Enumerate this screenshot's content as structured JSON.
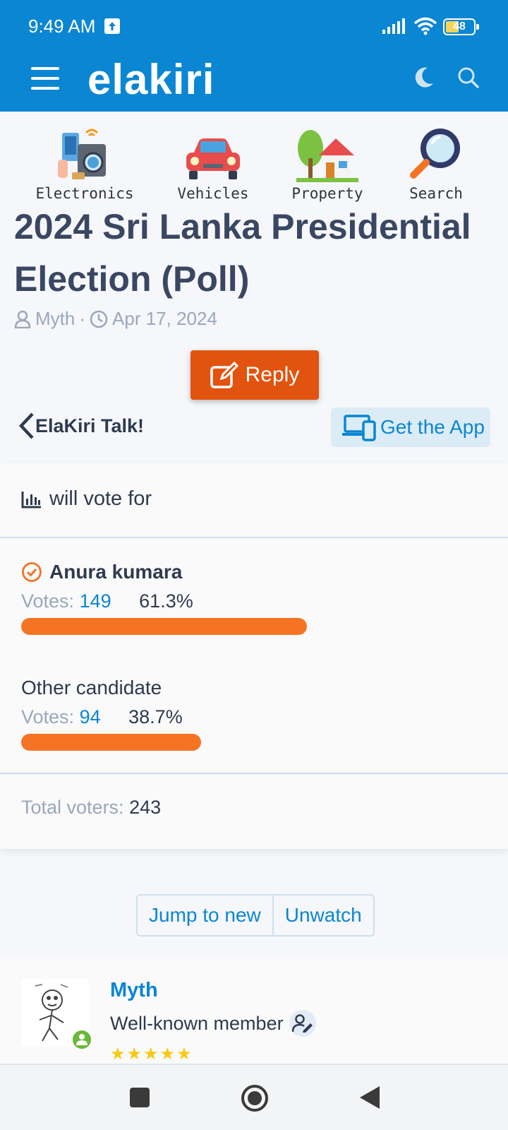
{
  "status_bar": {
    "time": "9:49 AM",
    "battery": "48",
    "battery_level": 0.48
  },
  "header": {
    "logo": "elakiri"
  },
  "categories": [
    {
      "label": "Electronics",
      "icon": "electronics-icon"
    },
    {
      "label": "Vehicles",
      "icon": "car-icon"
    },
    {
      "label": "Property",
      "icon": "house-icon"
    },
    {
      "label": "Search",
      "icon": "magnifier-icon"
    }
  ],
  "thread": {
    "title": "2024 Sri Lanka Presidential Election (Poll)",
    "author": "Myth",
    "separator": "·",
    "date": "Apr 17, 2024",
    "reply_label": "Reply",
    "back_label": "ElaKiri Talk!",
    "get_app_label": "Get the App"
  },
  "poll": {
    "question": "will vote for",
    "votes_label": "Votes:",
    "options": [
      {
        "name": "Anura kumara",
        "votes": "149",
        "percent": "61.3%",
        "share": 0.613,
        "selected": true
      },
      {
        "name": "Other candidate",
        "votes": "94",
        "percent": "38.7%",
        "share": 0.387,
        "selected": false
      }
    ],
    "total_label": "Total voters:",
    "total_value": "243",
    "bar_color": "#f47424"
  },
  "actions": {
    "jump_label": "Jump to new",
    "unwatch_label": "Unwatch"
  },
  "post": {
    "username": "Myth",
    "role": "Well-known member",
    "stars": "★★★★★"
  },
  "colors": {
    "brand": "#0a86d2",
    "reply": "#e2530f",
    "online": "#6ab83a"
  }
}
